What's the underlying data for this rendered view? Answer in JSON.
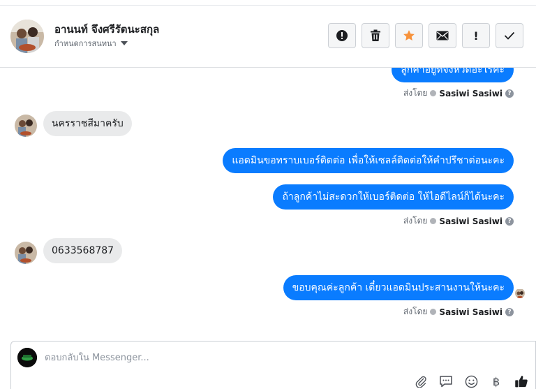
{
  "header": {
    "contact_name": "อานนท์ จึงศรีรัตนะสกุล",
    "assign_label": "กำหนดการสนทนา"
  },
  "toolbar": {
    "buttons": [
      {
        "name": "mark-spam",
        "icon": "alert-circle-icon"
      },
      {
        "name": "delete",
        "icon": "trash-icon"
      },
      {
        "name": "star",
        "icon": "star-icon",
        "color": "#f7923b"
      },
      {
        "name": "mark-unread",
        "icon": "envelope-icon"
      },
      {
        "name": "flag",
        "icon": "exclamation-icon",
        "label": "!"
      },
      {
        "name": "done",
        "icon": "check-icon"
      }
    ]
  },
  "thread": {
    "messages": [
      {
        "direction": "out",
        "text": "ลูกค้าอยู่ที่จังหวัดอะไรคะ"
      },
      {
        "direction": "in",
        "text": "นครราชสีมาครับ"
      },
      {
        "direction": "out",
        "text": "แอดมินขอทราบเบอร์ติดต่อ เพื่อให้เซลล์ติดต่อให้คำปรึชาต่อนะคะ"
      },
      {
        "direction": "out",
        "text": "ถ้าลูกค้าไม่สะดวกให้เบอร์ติดต่อ ให้ไอดีไลน์ก็ได้นะคะ"
      },
      {
        "direction": "in",
        "text": "0633568787"
      },
      {
        "direction": "out",
        "text": "ขอบคุณค่ะลูกค้า เดี๋ยวแอดมินประสานงานให้นะคะ"
      }
    ],
    "sent_by_prefix": "ส่งโดย",
    "sender": "Sasiwi Sasiwi"
  },
  "composer": {
    "placeholder": "ตอบกลับใน Messenger...",
    "tools": [
      "paperclip-icon",
      "speech-bubble-icon",
      "smiley-icon",
      "baht-icon",
      "thumbs-up-icon"
    ],
    "baht_symbol": "฿"
  },
  "colors": {
    "outgoing_bubble": "#0a7cff",
    "incoming_bubble": "#e9eaeb",
    "star": "#f7923b"
  }
}
